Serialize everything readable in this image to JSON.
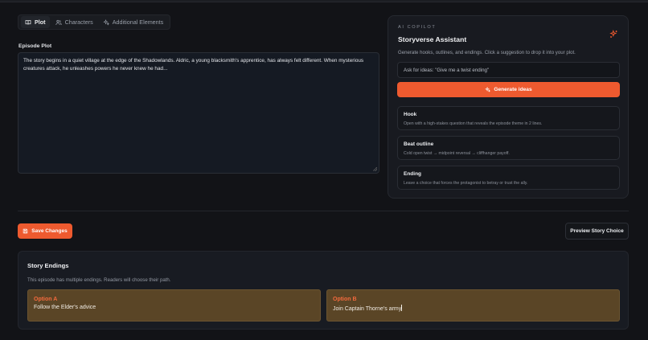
{
  "tabs": [
    {
      "label": "Plot",
      "icon": "book-icon",
      "active": true
    },
    {
      "label": "Characters",
      "icon": "users-icon",
      "active": false
    },
    {
      "label": "Additional Elements",
      "icon": "sparkles-icon",
      "active": false
    }
  ],
  "plot": {
    "label": "Episode Plot",
    "text": "The story begins in a quiet village at the edge of the Shadowlands. Aldric, a young blacksmith's apprentice, has always felt different. When mysterious creatures attack, he unleashes powers he never knew he had..."
  },
  "copilot": {
    "eyebrow": "AI COPILOT",
    "title": "Storyverse Assistant",
    "description": "Generate hooks, outlines, and endings. Click a suggestion to drop it into your plot.",
    "input_placeholder": "Ask for ideas: \"Give me a twist ending\"",
    "generate_label": "Generate ideas",
    "suggestions": [
      {
        "title": "Hook",
        "description": "Open with a high-stakes question that reveals the episode theme in 2 lines."
      },
      {
        "title": "Beat outline",
        "description": "Cold open twist → midpoint reversal → cliffhanger payoff."
      },
      {
        "title": "Ending",
        "description": "Leave a choice that forces the protagonist to betray or trust the ally."
      }
    ],
    "accent": "#ee5a2f"
  },
  "actions": {
    "save_label": "Save Changes",
    "preview_label": "Preview Story Choice"
  },
  "endings": {
    "title": "Story Endings",
    "description": "This episode has multiple endings. Readers will choose their path.",
    "options": [
      {
        "label": "Option A",
        "value": "Follow the Elder's advice"
      },
      {
        "label": "Option B",
        "value": "Join Captain Thorne's army"
      }
    ]
  }
}
